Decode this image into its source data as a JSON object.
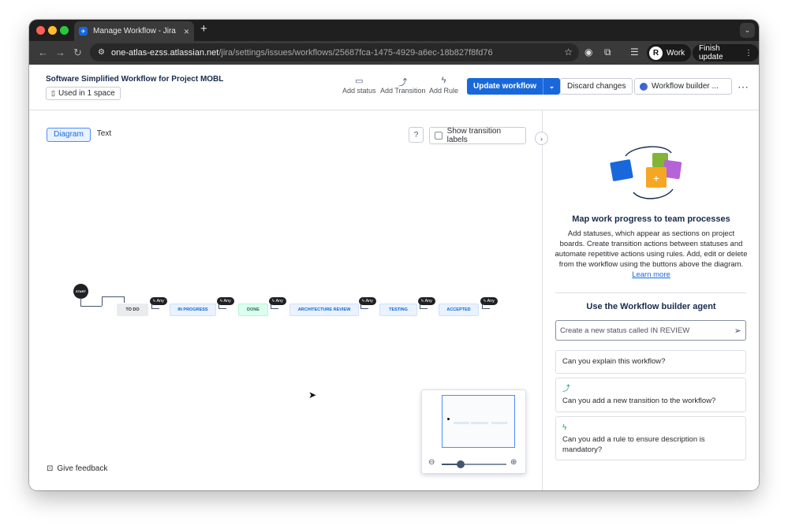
{
  "browser": {
    "tab_title": "Manage Workflow - Jira",
    "tab_close": "×",
    "new_tab": "+",
    "url_host": "one-atlas-ezss.atlassian.net",
    "url_path": "/jira/settings/issues/workflows/25687fca-1475-4929-a6ec-18b827f8fd76",
    "profile_initial": "R",
    "profile_label": "Work",
    "finish_update_label": "Finish update"
  },
  "header": {
    "workflow_title": "Software Simplified Workflow for Project MOBL",
    "used_in_label": "Used in 1 space",
    "tools": [
      {
        "label": "Add status",
        "icon": "status-icon"
      },
      {
        "label": "Add Transition",
        "icon": "transition-icon"
      },
      {
        "label": "Add Rule",
        "icon": "lightning-icon"
      }
    ],
    "update_label": "Update workflow",
    "discard_label": "Discard changes",
    "builder_label": "Workflow builder ..."
  },
  "canvas": {
    "view_tabs": [
      "Diagram",
      "Text"
    ],
    "active_view": "Diagram",
    "show_labels_text": "Show transition labels",
    "start_label": "START",
    "any_label": "Any",
    "statuses": [
      {
        "name": "TO DO",
        "category": "todo"
      },
      {
        "name": "IN PROGRESS",
        "category": "in-progress"
      },
      {
        "name": "DONE",
        "category": "done"
      },
      {
        "name": "ARCHITECTURE REVIEW",
        "category": "in-progress"
      },
      {
        "name": "TESTING",
        "category": "in-progress"
      },
      {
        "name": "ACCEPTED",
        "category": "in-progress"
      }
    ],
    "feedback_label": "Give feedback",
    "zoom_level": 0.29
  },
  "panel": {
    "title": "Map work progress to team processes",
    "description": "Add statuses, which appear as sections on project boards. Create transition actions between statuses and automate repetitive actions using rules. Add, edit or delete from the workflow using the buttons above the diagram.",
    "learn_more": "Learn more",
    "agent_title": "Use the Workflow builder agent",
    "agent_placeholder": "Create a new status called IN REVIEW",
    "suggestions": [
      {
        "text": "Can you explain this workflow?",
        "icon": ""
      },
      {
        "text": "Can you add a new transition to the workflow?",
        "icon": "transition-icon"
      },
      {
        "text": "Can you add a rule to ensure description is mandatory?",
        "icon": "lightning-icon"
      }
    ]
  },
  "colors": {
    "brand": "#1868db",
    "todo": "#e9ebee",
    "in_progress": "#e9f2ff",
    "done": "#dcfff1"
  }
}
